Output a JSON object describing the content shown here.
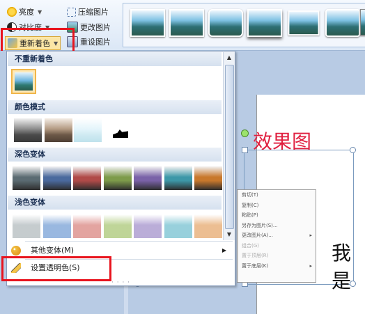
{
  "ribbon": {
    "brightness": "亮度",
    "contrast": "对比度",
    "recolor": "重新着色",
    "compress": "压缩图片",
    "change": "更改图片",
    "reset": "重设图片"
  },
  "dropdown": {
    "section_no_recolor": "不重新着色",
    "section_color_modes": "颜色模式",
    "section_dark": "深色变体",
    "section_light": "浅色变体",
    "more_variants": "其他变体(M)",
    "set_transparent": "设置透明色(S)",
    "dark_colors": [
      "#5b6b72",
      "#4a6a9e",
      "#b04a48",
      "#7d9b4a",
      "#7a62a8",
      "#3d97a8",
      "#c8782c"
    ],
    "light_colors": [
      "#bfc6c9",
      "#8eb0dc",
      "#e09a96",
      "#b8d08c",
      "#b3a4d4",
      "#8ccbd8",
      "#eab786"
    ],
    "accent": "#e8141e"
  },
  "slide": {
    "caption": "效果图",
    "big_char": "我是"
  },
  "context_menu": {
    "items": [
      {
        "label": "剪切(T)",
        "disabled": false,
        "submenu": false
      },
      {
        "label": "复制(C)",
        "disabled": false,
        "submenu": false
      },
      {
        "label": "粘贴(P)",
        "disabled": false,
        "submenu": false
      },
      {
        "label": "另存为图片(S)...",
        "disabled": false,
        "submenu": false
      },
      {
        "label": "更改图片(A)...",
        "disabled": false,
        "submenu": true
      },
      {
        "label": "组合(G)",
        "disabled": true,
        "submenu": false
      },
      {
        "label": "置于顶层(R)",
        "disabled": true,
        "submenu": false
      },
      {
        "label": "置于底层(K)",
        "disabled": false,
        "submenu": true
      }
    ]
  }
}
